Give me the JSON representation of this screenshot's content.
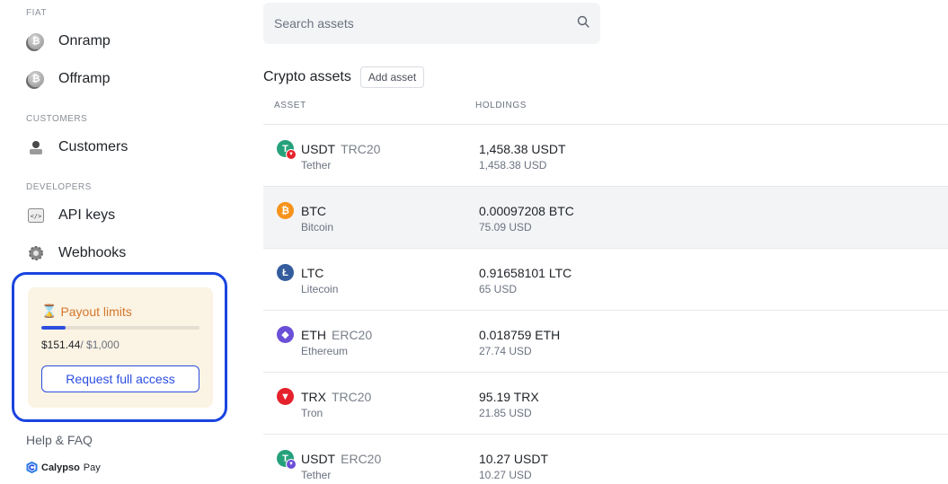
{
  "sidebar": {
    "fiat": {
      "label": "FIAT",
      "items": [
        {
          "label": "Onramp",
          "icon": "bitcoin-coin-icon"
        },
        {
          "label": "Offramp",
          "icon": "bitcoin-coin-icon"
        }
      ]
    },
    "customers": {
      "label": "CUSTOMERS",
      "items": [
        {
          "label": "Customers",
          "icon": "user-icon"
        }
      ]
    },
    "developers": {
      "label": "DEVELOPERS",
      "items": [
        {
          "label": "API keys",
          "icon": "code-icon"
        },
        {
          "label": "Webhooks",
          "icon": "gear-icon"
        }
      ]
    },
    "payout_limits": {
      "title": "Payout limits",
      "icon": "hourglass-icon",
      "used": "$151.44",
      "max": "/ $1,000",
      "progress_fraction": 0.15144,
      "button_label": "Request full access"
    },
    "help_label": "Help & FAQ",
    "brand": {
      "name_bold": "Calypso",
      "name_light": "Pay"
    }
  },
  "search": {
    "placeholder": "Search assets",
    "icon": "search-icon"
  },
  "assets": {
    "title": "Crypto assets",
    "add_label": "Add asset",
    "columns": {
      "asset": "ASSET",
      "holdings": "HOLDINGS"
    },
    "rows": [
      {
        "symbol": "USDT",
        "network": "TRC20",
        "name": "Tether",
        "amount": "1,458.38 USDT",
        "usd": "1,458.38 USD",
        "color": "#26a17b",
        "glyph": "T",
        "badge_color": "#e5222c"
      },
      {
        "symbol": "BTC",
        "network": "",
        "name": "Bitcoin",
        "amount": "0.00097208 BTC",
        "usd": "75.09 USD",
        "color": "#f7931a",
        "glyph": "₿",
        "badge_color": ""
      },
      {
        "symbol": "LTC",
        "network": "",
        "name": "Litecoin",
        "amount": "0.91658101 LTC",
        "usd": "65 USD",
        "color": "#345d9d",
        "glyph": "Ł",
        "badge_color": ""
      },
      {
        "symbol": "ETH",
        "network": "ERC20",
        "name": "Ethereum",
        "amount": "0.018759 ETH",
        "usd": "27.74 USD",
        "color": "#6b4fd8",
        "glyph": "◆",
        "badge_color": ""
      },
      {
        "symbol": "TRX",
        "network": "TRC20",
        "name": "Tron",
        "amount": "95.19 TRX",
        "usd": "21.85 USD",
        "color": "#e5222c",
        "glyph": "▼",
        "badge_color": ""
      },
      {
        "symbol": "USDT",
        "network": "ERC20",
        "name": "Tether",
        "amount": "10.27 USDT",
        "usd": "10.27 USD",
        "color": "#26a17b",
        "glyph": "T",
        "badge_color": "#6b4fd8"
      }
    ]
  }
}
